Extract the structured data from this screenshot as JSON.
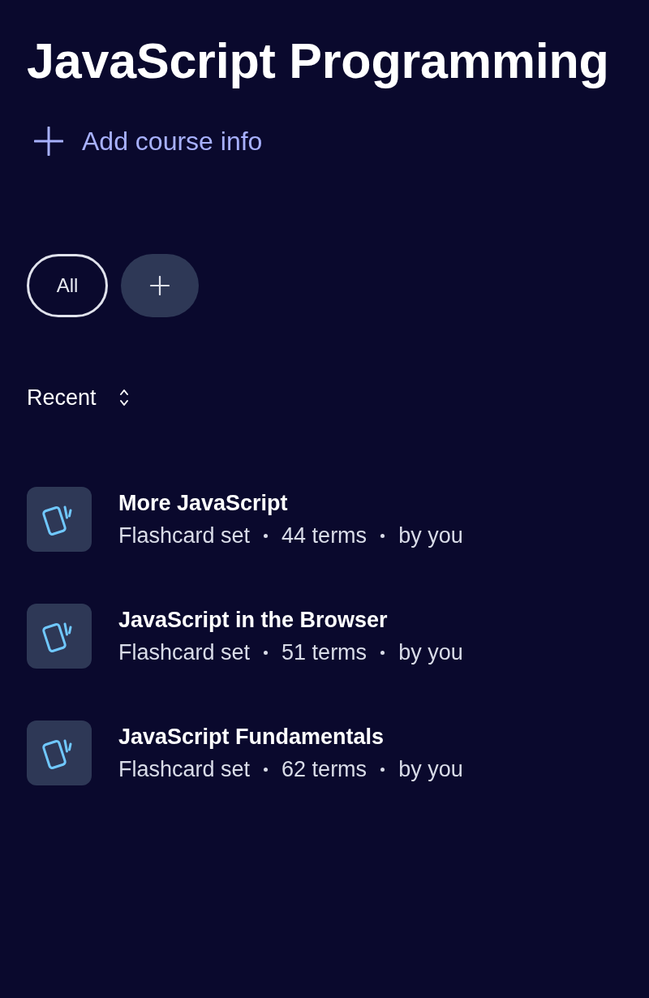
{
  "course": {
    "title": "JavaScript Programming",
    "add_info": "Add course info"
  },
  "filters": [
    {
      "label": "All",
      "selected": true
    }
  ],
  "sort": {
    "label": "Recent"
  },
  "sets": [
    {
      "title": "More JavaScript",
      "meta": [
        "Flashcard set",
        "44 terms",
        "by you"
      ]
    },
    {
      "title": "JavaScript in the Browser",
      "meta": [
        "Flashcard set",
        "51 terms",
        "by you"
      ]
    },
    {
      "title": "JavaScript Fundamentals",
      "meta": [
        "Flashcard set",
        "62 terms",
        "by you"
      ]
    }
  ]
}
